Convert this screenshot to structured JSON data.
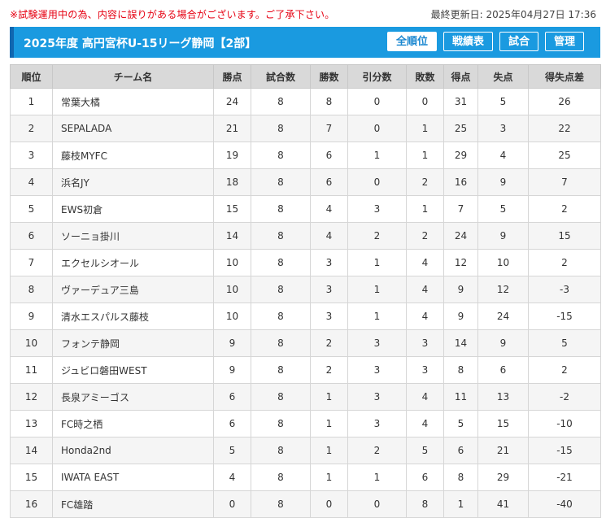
{
  "notice": "※試験運用中の為、内容に誤りがある場合がございます。ご了承下さい。",
  "updated": "最終更新日: 2025年04月27日 17:36",
  "header": {
    "title": "2025年度 高円宮杯U-15リーグ静岡【2部】",
    "buttons": [
      "全順位",
      "戦績表",
      "試合",
      "管理"
    ]
  },
  "table": {
    "headers": [
      "順位",
      "チーム名",
      "勝点",
      "試合数",
      "勝数",
      "引分数",
      "敗数",
      "得点",
      "失点",
      "得失点差"
    ],
    "rows": [
      [
        "1",
        "常葉大橘",
        "24",
        "8",
        "8",
        "0",
        "0",
        "31",
        "5",
        "26"
      ],
      [
        "2",
        "SEPALADA",
        "21",
        "8",
        "7",
        "0",
        "1",
        "25",
        "3",
        "22"
      ],
      [
        "3",
        "藤枝MYFC",
        "19",
        "8",
        "6",
        "1",
        "1",
        "29",
        "4",
        "25"
      ],
      [
        "4",
        "浜名JY",
        "18",
        "8",
        "6",
        "0",
        "2",
        "16",
        "9",
        "7"
      ],
      [
        "5",
        "EWS初倉",
        "15",
        "8",
        "4",
        "3",
        "1",
        "7",
        "5",
        "2"
      ],
      [
        "6",
        "ソーニョ掛川",
        "14",
        "8",
        "4",
        "2",
        "2",
        "24",
        "9",
        "15"
      ],
      [
        "7",
        "エクセルシオール",
        "10",
        "8",
        "3",
        "1",
        "4",
        "12",
        "10",
        "2"
      ],
      [
        "8",
        "ヴァーデュア三島",
        "10",
        "8",
        "3",
        "1",
        "4",
        "9",
        "12",
        "-3"
      ],
      [
        "9",
        "清水エスパルス藤枝",
        "10",
        "8",
        "3",
        "1",
        "4",
        "9",
        "24",
        "-15"
      ],
      [
        "10",
        "フォンテ静岡",
        "9",
        "8",
        "2",
        "3",
        "3",
        "14",
        "9",
        "5"
      ],
      [
        "11",
        "ジュビロ磐田WEST",
        "9",
        "8",
        "2",
        "3",
        "3",
        "8",
        "6",
        "2"
      ],
      [
        "12",
        "長泉アミーゴス",
        "6",
        "8",
        "1",
        "3",
        "4",
        "11",
        "13",
        "-2"
      ],
      [
        "13",
        "FC時之栖",
        "6",
        "8",
        "1",
        "3",
        "4",
        "5",
        "15",
        "-10"
      ],
      [
        "14",
        "Honda2nd",
        "5",
        "8",
        "1",
        "2",
        "5",
        "6",
        "21",
        "-15"
      ],
      [
        "15",
        "IWATA EAST",
        "4",
        "8",
        "1",
        "1",
        "6",
        "8",
        "29",
        "-21"
      ],
      [
        "16",
        "FC雄踏",
        "0",
        "8",
        "0",
        "0",
        "8",
        "1",
        "41",
        "-40"
      ]
    ]
  }
}
